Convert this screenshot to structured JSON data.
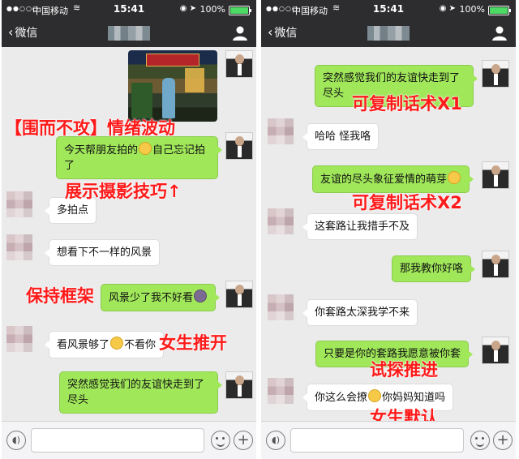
{
  "status_bar": {
    "carrier": "中国移动",
    "time": "15:41",
    "battery": "100%"
  },
  "nav": {
    "back_label": "微信"
  },
  "left_panel": {
    "messages": [
      {
        "from": "me",
        "kind": "image"
      },
      {
        "from": "me",
        "text_before": "今天帮朋友拍的",
        "emoji": "smirk",
        "text_after": "自己忘记拍了"
      },
      {
        "from": "other",
        "text": "多拍点"
      },
      {
        "from": "other",
        "text": "想看下不一样的风景"
      },
      {
        "from": "me",
        "text_before": "风景少了我不好看",
        "emoji": "sick",
        "text_after": ""
      },
      {
        "from": "other",
        "text_before": "看风景够了",
        "emoji": "laugh",
        "text_after": "不看你"
      },
      {
        "from": "me",
        "text": "突然感觉我们的友谊快走到了尽头"
      }
    ],
    "overlays": [
      "【围而不攻】情绪波动",
      "展示摄影技巧↑",
      "保持框架",
      "女生推开"
    ]
  },
  "right_panel": {
    "messages": [
      {
        "from": "me",
        "text": "突然感觉我们的友谊快走到了尽头"
      },
      {
        "from": "other",
        "text": "哈哈 怪我咯"
      },
      {
        "from": "me",
        "text_before": "友谊的尽头象征爱情的萌芽",
        "emoji": "smirk",
        "text_after": ""
      },
      {
        "from": "other",
        "text": "这套路让我措手不及"
      },
      {
        "from": "me",
        "text": "那我教你好咯"
      },
      {
        "from": "other",
        "text": "你套路太深我学不来"
      },
      {
        "from": "me",
        "text": "只要是你的套路我愿意被你套"
      },
      {
        "from": "other",
        "text_before": "你这么会撩",
        "emoji": "smirk",
        "text_after": "你妈妈知道吗"
      }
    ],
    "overlays": [
      "可复制话术X1",
      "可复制话术X2",
      "试探推进",
      "女生默认"
    ]
  },
  "icons": [
    "back-chevron-icon",
    "profile-icon",
    "voice-icon",
    "emoji-icon",
    "plus-icon",
    "wifi-icon",
    "battery-icon"
  ],
  "colors": {
    "bar_bg": "#2d2d2f",
    "chat_bg": "#ebebeb",
    "bubble_me": "#a0e75a",
    "bubble_other": "#ffffff",
    "overlay_text": "#ff1a1a"
  }
}
